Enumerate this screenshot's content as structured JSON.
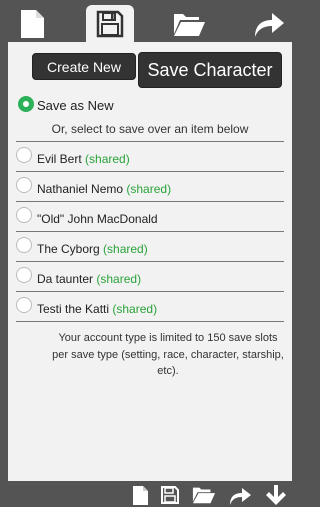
{
  "tabs": [
    {
      "name": "new-tab",
      "icon": "new-file-icon"
    },
    {
      "name": "save-tab",
      "icon": "save-icon",
      "active": true
    },
    {
      "name": "open-tab",
      "icon": "open-folder-icon"
    },
    {
      "name": "share-tab",
      "icon": "share-arrow-icon"
    }
  ],
  "buttons": {
    "create_new": "Create New",
    "save_character": "Save Character"
  },
  "save_as_new": "Save as New",
  "hint": "Or, select to save over an item below",
  "shared_label": "(shared)",
  "items": [
    {
      "name": "Evil Bert",
      "shared": true
    },
    {
      "name": "Nathaniel Nemo",
      "shared": true
    },
    {
      "name": "\"Old\" John MacDonald",
      "shared": false
    },
    {
      "name": "The Cyborg",
      "shared": true
    },
    {
      "name": "Da taunter",
      "shared": true
    },
    {
      "name": "Testi the Katti",
      "shared": true
    }
  ],
  "note": "Your account type is limited to 150 save slots per save type (setting, race, character, starship, etc).",
  "bottom_icons": [
    "new-file-icon",
    "save-icon",
    "open-folder-icon",
    "share-arrow-icon",
    "down-arrow-icon"
  ],
  "colors": {
    "accent": "#2db05a",
    "shared": "#2aa33a",
    "background": "#545454",
    "panel": "#f2f2f2",
    "button": "#333333"
  }
}
